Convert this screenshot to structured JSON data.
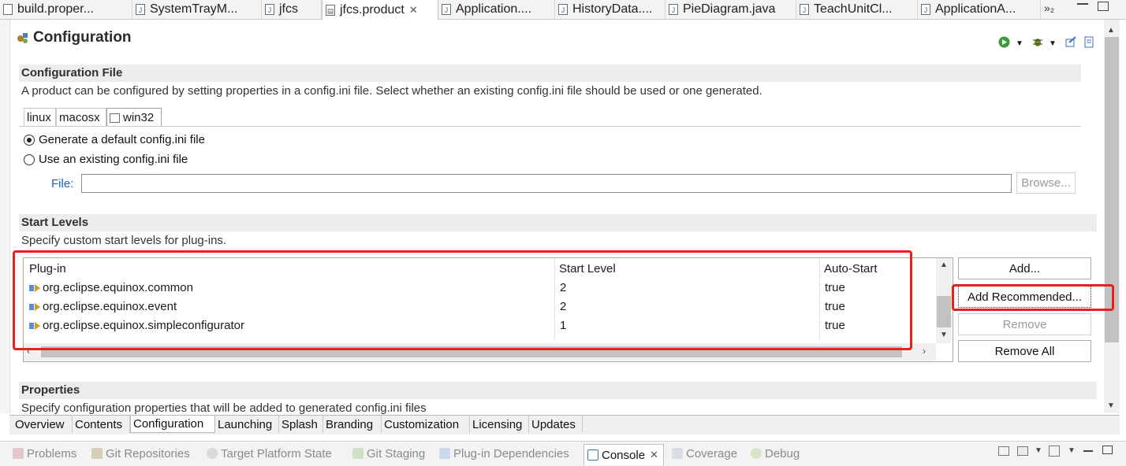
{
  "editor_tabs": [
    {
      "label": "build.proper...",
      "icon": "file-icon"
    },
    {
      "label": "SystemTrayM...",
      "icon": "java-file-icon"
    },
    {
      "label": "jfcs",
      "icon": "java-file-icon"
    },
    {
      "label": "jfcs.product",
      "icon": "product-file-icon",
      "active": true
    },
    {
      "label": "Application....",
      "icon": "java-file-icon"
    },
    {
      "label": "HistoryData....",
      "icon": "java-file-icon"
    },
    {
      "label": "PieDiagram.java",
      "icon": "java-file-icon"
    },
    {
      "label": "TeachUnitCl...",
      "icon": "java-file-icon"
    },
    {
      "label": "ApplicationA...",
      "icon": "java-file-icon"
    }
  ],
  "overflow_label": "»₂",
  "page_title": "Configuration",
  "config_file": {
    "title": "Configuration File",
    "description": "A product can be configured by setting properties in a config.ini file.  Select whether an existing config.ini file should be used or one generated.",
    "os_tabs": [
      "linux",
      "macosx",
      "win32"
    ],
    "active_os": "win32",
    "radio_generate": "Generate a default config.ini file",
    "radio_existing": "Use an existing config.ini file",
    "selected": "generate",
    "file_label": "File:",
    "file_value": "",
    "browse_label": "Browse..."
  },
  "start_levels": {
    "title": "Start Levels",
    "description": "Specify custom start levels for plug-ins.",
    "columns": [
      "Plug-in",
      "Start Level",
      "Auto-Start"
    ],
    "rows": [
      {
        "plugin": "org.eclipse.equinox.common",
        "level": "2",
        "auto": "true"
      },
      {
        "plugin": "org.eclipse.equinox.event",
        "level": "2",
        "auto": "true"
      },
      {
        "plugin": "org.eclipse.equinox.simpleconfigurator",
        "level": "1",
        "auto": "true"
      }
    ],
    "buttons": {
      "add": "Add...",
      "add_recommended": "Add Recommended...",
      "remove": "Remove",
      "remove_all": "Remove All"
    }
  },
  "properties": {
    "title": "Properties",
    "description": "Specify configuration properties that will be added to generated config.ini files"
  },
  "page_tabs": [
    "Overview",
    "Contents",
    "Configuration",
    "Launching",
    "Splash",
    "Branding",
    "Customization",
    "Licensing",
    "Updates"
  ],
  "active_page_tab": "Configuration",
  "view_tabs": [
    {
      "label": "Problems",
      "icon": "problems-icon"
    },
    {
      "label": "Git Repositories",
      "icon": "git-repo-icon"
    },
    {
      "label": "Target Platform State",
      "icon": "target-icon"
    },
    {
      "label": "Git Staging",
      "icon": "git-staging-icon"
    },
    {
      "label": "Plug-in Dependencies",
      "icon": "plugin-deps-icon"
    },
    {
      "label": "Console",
      "icon": "console-icon",
      "active": true
    },
    {
      "label": "Coverage",
      "icon": "coverage-icon"
    },
    {
      "label": "Debug",
      "icon": "debug-icon"
    }
  ],
  "colors": {
    "highlight_red": "#e8201c",
    "link_blue": "#1d5fb7",
    "section_bg": "#ececec"
  }
}
